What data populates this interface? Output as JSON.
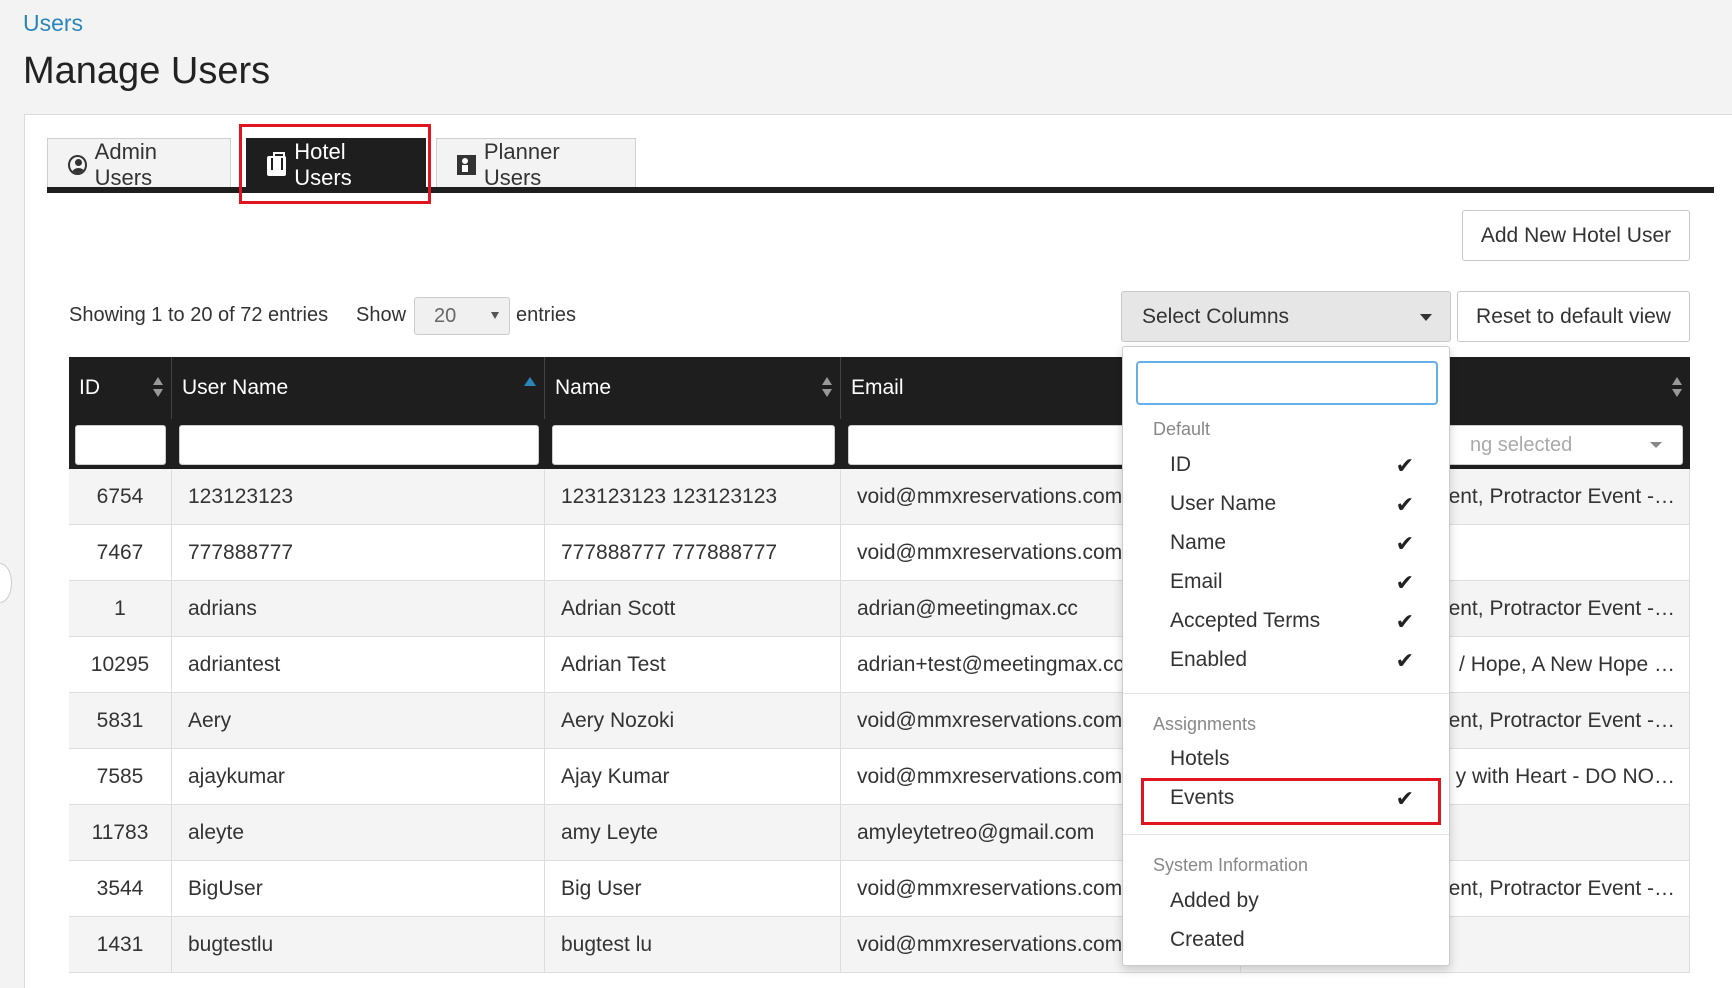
{
  "breadcrumb": "Users",
  "page_title": "Manage Users",
  "tabs": {
    "admin": "Admin Users",
    "hotel": "Hotel Users",
    "planner": "Planner Users"
  },
  "buttons": {
    "add_new": "Add New Hotel User",
    "select_columns": "Select Columns",
    "reset": "Reset to default view"
  },
  "paging": {
    "showing": "Showing 1 to 20 of 72 entries",
    "show_label": "Show",
    "page_size": "20",
    "entries_label": "entries"
  },
  "table": {
    "columns": [
      "ID",
      "User Name",
      "Name",
      "Email"
    ],
    "events_filter_placeholder": "ng selected",
    "rows": [
      {
        "id": "6754",
        "username": "123123123",
        "name": "123123123 123123123",
        "email": "void@mmxreservations.com",
        "events": "ent, Protractor Event -…"
      },
      {
        "id": "7467",
        "username": "777888777",
        "name": "777888777 777888777",
        "email": "void@mmxreservations.com",
        "events": ""
      },
      {
        "id": "1",
        "username": "adrians",
        "name": "Adrian Scott",
        "email": "adrian@meetingmax.cc",
        "events": "ent, Protractor Event -…"
      },
      {
        "id": "10295",
        "username": "adriantest",
        "name": "Adrian Test",
        "email": "adrian+test@meetingmax.cc",
        "events": "/ Hope, A New Hope …"
      },
      {
        "id": "5831",
        "username": "Aery",
        "name": "Aery Nozoki",
        "email": "void@mmxreservations.com",
        "events": "ent, Protractor Event -…"
      },
      {
        "id": "7585",
        "username": "ajaykumar",
        "name": "Ajay Kumar",
        "email": "void@mmxreservations.com",
        "events": "y with Heart - DO NO…"
      },
      {
        "id": "11783",
        "username": "aleyte",
        "name": "amy Leyte",
        "email": "amyleytetreo@gmail.com",
        "events": ""
      },
      {
        "id": "3544",
        "username": "BigUser",
        "name": "Big User",
        "email": "void@mmxreservations.com",
        "events": "ent, Protractor Event -…"
      },
      {
        "id": "1431",
        "username": "bugtestlu",
        "name": "bugtest lu",
        "email": "void@mmxreservations.com",
        "events": ""
      }
    ]
  },
  "column_menu": {
    "groups": {
      "default": "Default",
      "assignments": "Assignments",
      "system": "System Information"
    },
    "items": {
      "id": "ID",
      "username": "User Name",
      "name": "Name",
      "email": "Email",
      "accepted_terms": "Accepted Terms",
      "enabled": "Enabled",
      "hotels": "Hotels",
      "events": "Events",
      "added_by": "Added by",
      "created": "Created"
    },
    "check_glyph": "✔"
  },
  "colors": {
    "link": "#2a86b8",
    "header_bg": "#1e1e1e",
    "highlight": "#e0151f",
    "focus": "#66afe9"
  }
}
